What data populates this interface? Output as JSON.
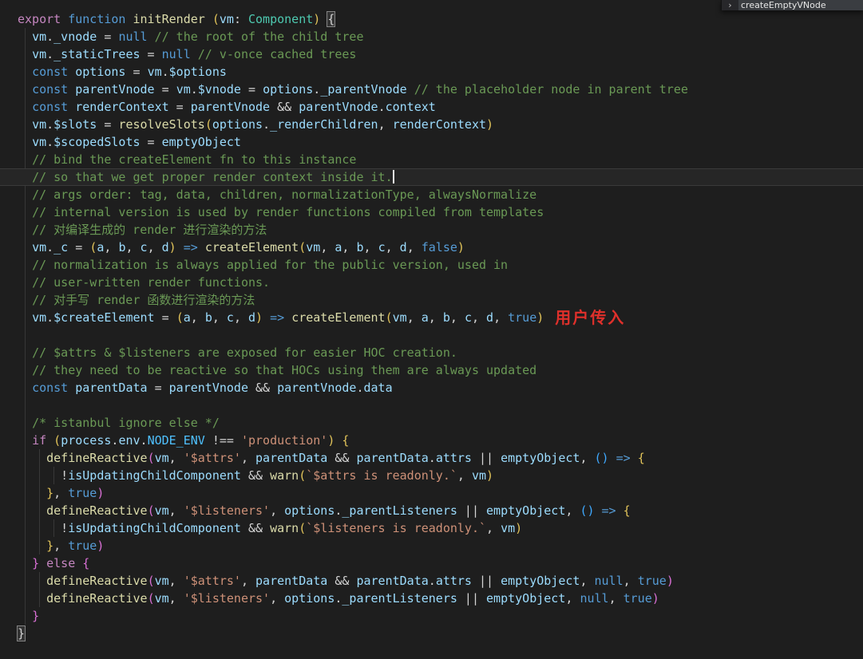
{
  "editor": {
    "background": "#1e1e1e",
    "current_line": 9,
    "colors": {
      "p": "#C586C0",
      "k": "#569CD6",
      "f": "#DCDCAA",
      "v": "#9CDCFE",
      "t": "#4EC9B0",
      "C": "#4FC1FF",
      "s": "#CE9178",
      "c": "#6A9955",
      "o": "#D4D4D4",
      "g": "#E2C45A",
      "m": "#DA70D6",
      "u": "#3FA9FF",
      "x": "#D4D4D4",
      "r": "#E0302B"
    },
    "lines": [
      [
        [
          "p",
          "export"
        ],
        [
          "o",
          " "
        ],
        [
          "k",
          "function"
        ],
        [
          "o",
          " "
        ],
        [
          "f",
          "initRender"
        ],
        [
          "o",
          " "
        ],
        [
          "g",
          "("
        ],
        [
          "v",
          "vm"
        ],
        [
          "o",
          ": "
        ],
        [
          "t",
          "Component"
        ],
        [
          "g",
          ")"
        ],
        [
          "o",
          " "
        ],
        [
          "x",
          "{"
        ]
      ],
      [
        [
          "o",
          "  "
        ],
        [
          "v",
          "vm"
        ],
        [
          "o",
          "."
        ],
        [
          "v",
          "_vnode"
        ],
        [
          "o",
          " = "
        ],
        [
          "k",
          "null"
        ],
        [
          "o",
          " "
        ],
        [
          "c",
          "// the root of the child tree"
        ]
      ],
      [
        [
          "o",
          "  "
        ],
        [
          "v",
          "vm"
        ],
        [
          "o",
          "."
        ],
        [
          "v",
          "_staticTrees"
        ],
        [
          "o",
          " = "
        ],
        [
          "k",
          "null"
        ],
        [
          "o",
          " "
        ],
        [
          "c",
          "// v-once cached trees"
        ]
      ],
      [
        [
          "o",
          "  "
        ],
        [
          "k",
          "const"
        ],
        [
          "o",
          " "
        ],
        [
          "v",
          "options"
        ],
        [
          "o",
          " = "
        ],
        [
          "v",
          "vm"
        ],
        [
          "o",
          "."
        ],
        [
          "v",
          "$options"
        ]
      ],
      [
        [
          "o",
          "  "
        ],
        [
          "k",
          "const"
        ],
        [
          "o",
          " "
        ],
        [
          "v",
          "parentVnode"
        ],
        [
          "o",
          " = "
        ],
        [
          "v",
          "vm"
        ],
        [
          "o",
          "."
        ],
        [
          "v",
          "$vnode"
        ],
        [
          "o",
          " = "
        ],
        [
          "v",
          "options"
        ],
        [
          "o",
          "."
        ],
        [
          "v",
          "_parentVnode"
        ],
        [
          "o",
          " "
        ],
        [
          "c",
          "// the placeholder node in parent tree"
        ]
      ],
      [
        [
          "o",
          "  "
        ],
        [
          "k",
          "const"
        ],
        [
          "o",
          " "
        ],
        [
          "v",
          "renderContext"
        ],
        [
          "o",
          " = "
        ],
        [
          "v",
          "parentVnode"
        ],
        [
          "o",
          " && "
        ],
        [
          "v",
          "parentVnode"
        ],
        [
          "o",
          "."
        ],
        [
          "v",
          "context"
        ]
      ],
      [
        [
          "o",
          "  "
        ],
        [
          "v",
          "vm"
        ],
        [
          "o",
          "."
        ],
        [
          "v",
          "$slots"
        ],
        [
          "o",
          " = "
        ],
        [
          "f",
          "resolveSlots"
        ],
        [
          "g",
          "("
        ],
        [
          "v",
          "options"
        ],
        [
          "o",
          "."
        ],
        [
          "v",
          "_renderChildren"
        ],
        [
          "o",
          ", "
        ],
        [
          "v",
          "renderContext"
        ],
        [
          "g",
          ")"
        ]
      ],
      [
        [
          "o",
          "  "
        ],
        [
          "v",
          "vm"
        ],
        [
          "o",
          "."
        ],
        [
          "v",
          "$scopedSlots"
        ],
        [
          "o",
          " = "
        ],
        [
          "v",
          "emptyObject"
        ]
      ],
      [
        [
          "o",
          "  "
        ],
        [
          "c",
          "// bind the createElement fn to this instance"
        ]
      ],
      [
        [
          "o",
          "  "
        ],
        [
          "c",
          "// so that we get proper render context inside it."
        ],
        [
          "cur",
          ""
        ]
      ],
      [
        [
          "o",
          "  "
        ],
        [
          "c",
          "// args order: tag, data, children, normalizationType, alwaysNormalize"
        ]
      ],
      [
        [
          "o",
          "  "
        ],
        [
          "c",
          "// internal version is used by render functions compiled from templates"
        ]
      ],
      [
        [
          "o",
          "  "
        ],
        [
          "c",
          "// 对编译生成的 render 进行渲染的方法"
        ]
      ],
      [
        [
          "o",
          "  "
        ],
        [
          "v",
          "vm"
        ],
        [
          "o",
          "."
        ],
        [
          "v",
          "_c"
        ],
        [
          "o",
          " = "
        ],
        [
          "g",
          "("
        ],
        [
          "v",
          "a"
        ],
        [
          "o",
          ", "
        ],
        [
          "v",
          "b"
        ],
        [
          "o",
          ", "
        ],
        [
          "v",
          "c"
        ],
        [
          "o",
          ", "
        ],
        [
          "v",
          "d"
        ],
        [
          "g",
          ")"
        ],
        [
          "o",
          " "
        ],
        [
          "k",
          "=>"
        ],
        [
          "o",
          " "
        ],
        [
          "f",
          "createElement"
        ],
        [
          "g",
          "("
        ],
        [
          "v",
          "vm"
        ],
        [
          "o",
          ", "
        ],
        [
          "v",
          "a"
        ],
        [
          "o",
          ", "
        ],
        [
          "v",
          "b"
        ],
        [
          "o",
          ", "
        ],
        [
          "v",
          "c"
        ],
        [
          "o",
          ", "
        ],
        [
          "v",
          "d"
        ],
        [
          "o",
          ", "
        ],
        [
          "k",
          "false"
        ],
        [
          "g",
          ")"
        ]
      ],
      [
        [
          "o",
          "  "
        ],
        [
          "c",
          "// normalization is always applied for the public version, used in"
        ]
      ],
      [
        [
          "o",
          "  "
        ],
        [
          "c",
          "// user-written render functions."
        ]
      ],
      [
        [
          "o",
          "  "
        ],
        [
          "c",
          "// 对手写 render 函数进行渲染的方法"
        ]
      ],
      [
        [
          "o",
          "  "
        ],
        [
          "v",
          "vm"
        ],
        [
          "o",
          "."
        ],
        [
          "v",
          "$createElement"
        ],
        [
          "o",
          " = "
        ],
        [
          "g",
          "("
        ],
        [
          "v",
          "a"
        ],
        [
          "o",
          ", "
        ],
        [
          "v",
          "b"
        ],
        [
          "o",
          ", "
        ],
        [
          "v",
          "c"
        ],
        [
          "o",
          ", "
        ],
        [
          "v",
          "d"
        ],
        [
          "g",
          ")"
        ],
        [
          "o",
          " "
        ],
        [
          "k",
          "=>"
        ],
        [
          "o",
          " "
        ],
        [
          "f",
          "createElement"
        ],
        [
          "g",
          "("
        ],
        [
          "v",
          "vm"
        ],
        [
          "o",
          ", "
        ],
        [
          "v",
          "a"
        ],
        [
          "o",
          ", "
        ],
        [
          "v",
          "b"
        ],
        [
          "o",
          ", "
        ],
        [
          "v",
          "c"
        ],
        [
          "o",
          ", "
        ],
        [
          "v",
          "d"
        ],
        [
          "o",
          ", "
        ],
        [
          "k",
          "true"
        ],
        [
          "g",
          ")"
        ],
        [
          "r",
          "用户传入"
        ]
      ],
      [],
      [
        [
          "o",
          "  "
        ],
        [
          "c",
          "// $attrs & $listeners are exposed for easier HOC creation."
        ]
      ],
      [
        [
          "o",
          "  "
        ],
        [
          "c",
          "// they need to be reactive so that HOCs using them are always updated"
        ]
      ],
      [
        [
          "o",
          "  "
        ],
        [
          "k",
          "const"
        ],
        [
          "o",
          " "
        ],
        [
          "v",
          "parentData"
        ],
        [
          "o",
          " = "
        ],
        [
          "v",
          "parentVnode"
        ],
        [
          "o",
          " && "
        ],
        [
          "v",
          "parentVnode"
        ],
        [
          "o",
          "."
        ],
        [
          "v",
          "data"
        ]
      ],
      [],
      [
        [
          "o",
          "  "
        ],
        [
          "c",
          "/* istanbul ignore else */"
        ]
      ],
      [
        [
          "o",
          "  "
        ],
        [
          "p",
          "if"
        ],
        [
          "o",
          " "
        ],
        [
          "g",
          "("
        ],
        [
          "v",
          "process"
        ],
        [
          "o",
          "."
        ],
        [
          "v",
          "env"
        ],
        [
          "o",
          "."
        ],
        [
          "C",
          "NODE_ENV"
        ],
        [
          "o",
          " !== "
        ],
        [
          "s",
          "'production'"
        ],
        [
          "g",
          ")"
        ],
        [
          "o",
          " "
        ],
        [
          "g",
          "{"
        ]
      ],
      [
        [
          "o",
          "    "
        ],
        [
          "f",
          "defineReactive"
        ],
        [
          "m",
          "("
        ],
        [
          "v",
          "vm"
        ],
        [
          "o",
          ", "
        ],
        [
          "s",
          "'$attrs'"
        ],
        [
          "o",
          ", "
        ],
        [
          "v",
          "parentData"
        ],
        [
          "o",
          " && "
        ],
        [
          "v",
          "parentData"
        ],
        [
          "o",
          "."
        ],
        [
          "v",
          "attrs"
        ],
        [
          "o",
          " || "
        ],
        [
          "v",
          "emptyObject"
        ],
        [
          "o",
          ", "
        ],
        [
          "u",
          "()"
        ],
        [
          "o",
          " "
        ],
        [
          "k",
          "=>"
        ],
        [
          "o",
          " "
        ],
        [
          "g",
          "{"
        ]
      ],
      [
        [
          "o",
          "      !"
        ],
        [
          "v",
          "isUpdatingChildComponent"
        ],
        [
          "o",
          " && "
        ],
        [
          "f",
          "warn"
        ],
        [
          "g",
          "("
        ],
        [
          "s",
          "`$attrs is readonly.`"
        ],
        [
          "o",
          ", "
        ],
        [
          "v",
          "vm"
        ],
        [
          "g",
          ")"
        ]
      ],
      [
        [
          "o",
          "    "
        ],
        [
          "g",
          "}"
        ],
        [
          "o",
          ", "
        ],
        [
          "k",
          "true"
        ],
        [
          "m",
          ")"
        ]
      ],
      [
        [
          "o",
          "    "
        ],
        [
          "f",
          "defineReactive"
        ],
        [
          "m",
          "("
        ],
        [
          "v",
          "vm"
        ],
        [
          "o",
          ", "
        ],
        [
          "s",
          "'$listeners'"
        ],
        [
          "o",
          ", "
        ],
        [
          "v",
          "options"
        ],
        [
          "o",
          "."
        ],
        [
          "v",
          "_parentListeners"
        ],
        [
          "o",
          " || "
        ],
        [
          "v",
          "emptyObject"
        ],
        [
          "o",
          ", "
        ],
        [
          "u",
          "()"
        ],
        [
          "o",
          " "
        ],
        [
          "k",
          "=>"
        ],
        [
          "o",
          " "
        ],
        [
          "g",
          "{"
        ]
      ],
      [
        [
          "o",
          "      !"
        ],
        [
          "v",
          "isUpdatingChildComponent"
        ],
        [
          "o",
          " && "
        ],
        [
          "f",
          "warn"
        ],
        [
          "g",
          "("
        ],
        [
          "s",
          "`$listeners is readonly.`"
        ],
        [
          "o",
          ", "
        ],
        [
          "v",
          "vm"
        ],
        [
          "g",
          ")"
        ]
      ],
      [
        [
          "o",
          "    "
        ],
        [
          "g",
          "}"
        ],
        [
          "o",
          ", "
        ],
        [
          "k",
          "true"
        ],
        [
          "m",
          ")"
        ]
      ],
      [
        [
          "o",
          "  "
        ],
        [
          "m",
          "}"
        ],
        [
          "o",
          " "
        ],
        [
          "p",
          "else"
        ],
        [
          "o",
          " "
        ],
        [
          "m",
          "{"
        ]
      ],
      [
        [
          "o",
          "    "
        ],
        [
          "f",
          "defineReactive"
        ],
        [
          "m",
          "("
        ],
        [
          "v",
          "vm"
        ],
        [
          "o",
          ", "
        ],
        [
          "s",
          "'$attrs'"
        ],
        [
          "o",
          ", "
        ],
        [
          "v",
          "parentData"
        ],
        [
          "o",
          " && "
        ],
        [
          "v",
          "parentData"
        ],
        [
          "o",
          "."
        ],
        [
          "v",
          "attrs"
        ],
        [
          "o",
          " || "
        ],
        [
          "v",
          "emptyObject"
        ],
        [
          "o",
          ", "
        ],
        [
          "k",
          "null"
        ],
        [
          "o",
          ", "
        ],
        [
          "k",
          "true"
        ],
        [
          "m",
          ")"
        ]
      ],
      [
        [
          "o",
          "    "
        ],
        [
          "f",
          "defineReactive"
        ],
        [
          "m",
          "("
        ],
        [
          "v",
          "vm"
        ],
        [
          "o",
          ", "
        ],
        [
          "s",
          "'$listeners'"
        ],
        [
          "o",
          ", "
        ],
        [
          "v",
          "options"
        ],
        [
          "o",
          "."
        ],
        [
          "v",
          "_parentListeners"
        ],
        [
          "o",
          " || "
        ],
        [
          "v",
          "emptyObject"
        ],
        [
          "o",
          ", "
        ],
        [
          "k",
          "null"
        ],
        [
          "o",
          ", "
        ],
        [
          "k",
          "true"
        ],
        [
          "m",
          ")"
        ]
      ],
      [
        [
          "o",
          "  "
        ],
        [
          "m",
          "}"
        ]
      ],
      [
        [
          "x",
          "}"
        ]
      ]
    ]
  },
  "popup": {
    "chevron": "›",
    "label": "createEmptyVNode"
  }
}
